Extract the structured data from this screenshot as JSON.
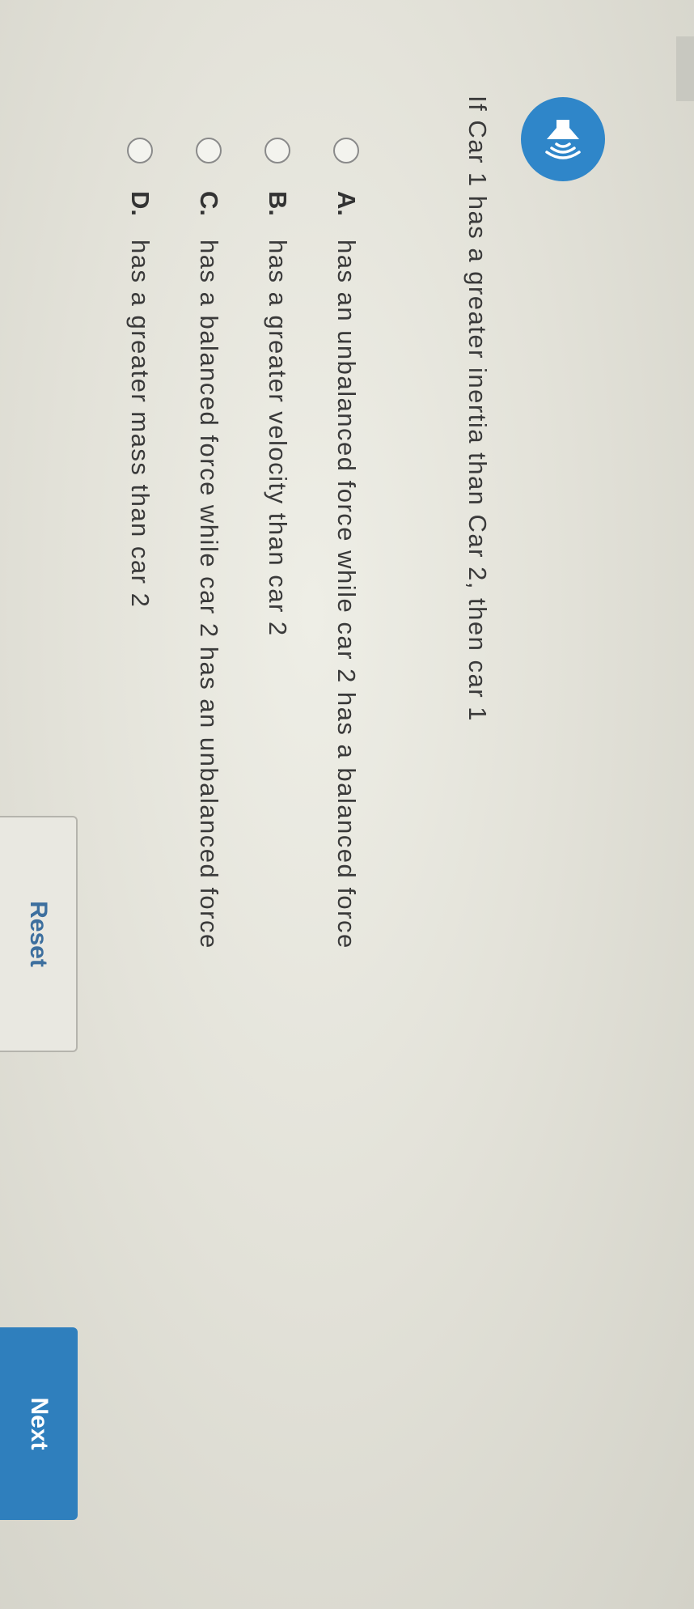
{
  "question": {
    "text": "If Car 1 has a greater inertia than Car 2, then car 1",
    "audio_icon": "speaker-sound-icon"
  },
  "options": [
    {
      "letter": "A.",
      "text": "has an unbalanced force while car 2 has a balanced force"
    },
    {
      "letter": "B.",
      "text": "has a greater velocity than car 2"
    },
    {
      "letter": "C.",
      "text": "has a balanced force while car 2 has an unbalanced force"
    },
    {
      "letter": "D.",
      "text": "has a greater mass than car 2"
    }
  ],
  "buttons": {
    "reset_label": "Reset",
    "next_label": "Next"
  },
  "colors": {
    "accent": "#2f7fbd",
    "speaker": "#2f86c9",
    "reset_text": "#3d6f9e"
  }
}
